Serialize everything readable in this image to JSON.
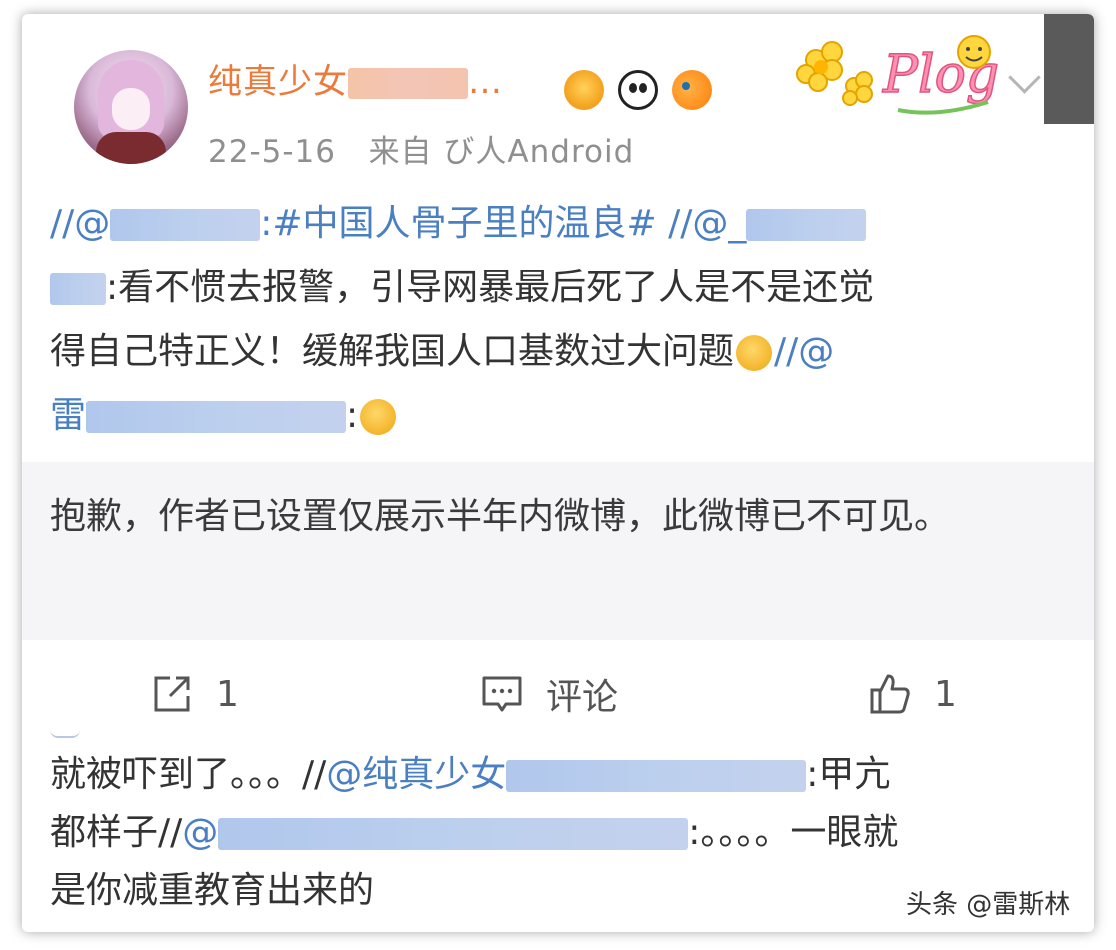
{
  "post": {
    "username": "纯真少女",
    "username_suffix": "…",
    "date": "22-5-16",
    "source": "来自 び人Android",
    "plog_text": "Plog"
  },
  "content": {
    "line1_prefix": "//@",
    "line1_topic": ":#中国人骨子里的温良#",
    "line1_sep": " //@_",
    "line2_text": ":看不惯去报警，引导网暴最后死了人是不是还觉",
    "line3_text": "得自己特正义！缓解我国人口基数过大问题",
    "line3_tail": "//@",
    "line4_prefix": "雷",
    "line4_colon": ":"
  },
  "notice": {
    "text": "抱歉，作者已设置仅展示半年内微博，此微博已不可见。"
  },
  "actions": {
    "share_count": "1",
    "comment_label": "评论",
    "like_count": "1"
  },
  "repost": {
    "line1_text": "就被吓到了。。。//",
    "line1_at": "@纯真少女",
    "line1_tail": ":甲亢",
    "line2_text": "都样子//",
    "line2_at": "@",
    "line2_tail": ":。。。。一眼就",
    "line3_text": "是你减重教育出来的"
  },
  "watermark": "头条 @雷斯林",
  "colors": {
    "username": "#eb7a3b",
    "link": "#4a7fc2",
    "notice_bg": "#f5f5f7"
  }
}
